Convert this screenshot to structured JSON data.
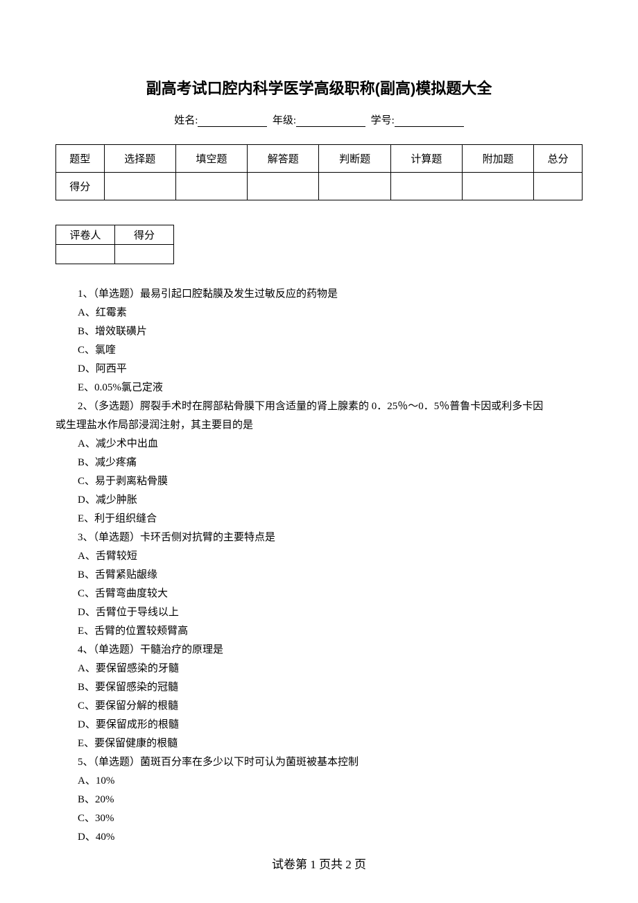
{
  "title": "副高考试口腔内科学医学高级职称(副高)模拟题大全",
  "info": {
    "name_label": "姓名:",
    "grade_label": "年级:",
    "id_label": "学号:"
  },
  "main_table": {
    "headers": [
      "题型",
      "选择题",
      "填空题",
      "解答题",
      "判断题",
      "计算题",
      "附加题",
      "总分"
    ],
    "row2_label": "得分"
  },
  "eval_table": {
    "col1": "评卷人",
    "col2": "得分"
  },
  "questions": [
    {
      "text": "1、（单选题）最易引起口腔黏膜及发生过敏反应的药物是",
      "options": [
        "A、红霉素",
        "B、增效联磺片",
        "C、氯喹",
        "D、阿西平",
        "E、0.05%氯己定液"
      ]
    },
    {
      "text": "2、（多选题）腭裂手术时在腭部粘骨膜下用含适量的肾上腺素的 0．25％～0．5％普鲁卡因或利多卡因",
      "continuation": "或生理盐水作局部浸润注射，其主要目的是",
      "options": [
        "A、减少术中出血",
        "B、减少疼痛",
        "C、易于剥离粘骨膜",
        "D、减少肿胀",
        "E、利于组织缝合"
      ]
    },
    {
      "text": "3、（单选题）卡环舌侧对抗臂的主要特点是",
      "options": [
        "A、舌臂较短",
        "B、舌臂紧贴龈缘",
        "C、舌臂弯曲度较大",
        "D、舌臂位于导线以上",
        "E、舌臂的位置较颊臂高"
      ]
    },
    {
      "text": "4、（单选题）干髓治疗的原理是",
      "options": [
        "A、要保留感染的牙髓",
        "B、要保留感染的冠髓",
        "C、要保留分解的根髓",
        "D、要保留成形的根髓",
        "E、要保留健康的根髓"
      ]
    },
    {
      "text": "5、（单选题）菌斑百分率在多少以下时可认为菌斑被基本控制",
      "options": [
        "A、10%",
        "B、20%",
        "C、30%",
        "D、40%"
      ]
    }
  ],
  "footer": "试卷第 1 页共 2 页"
}
